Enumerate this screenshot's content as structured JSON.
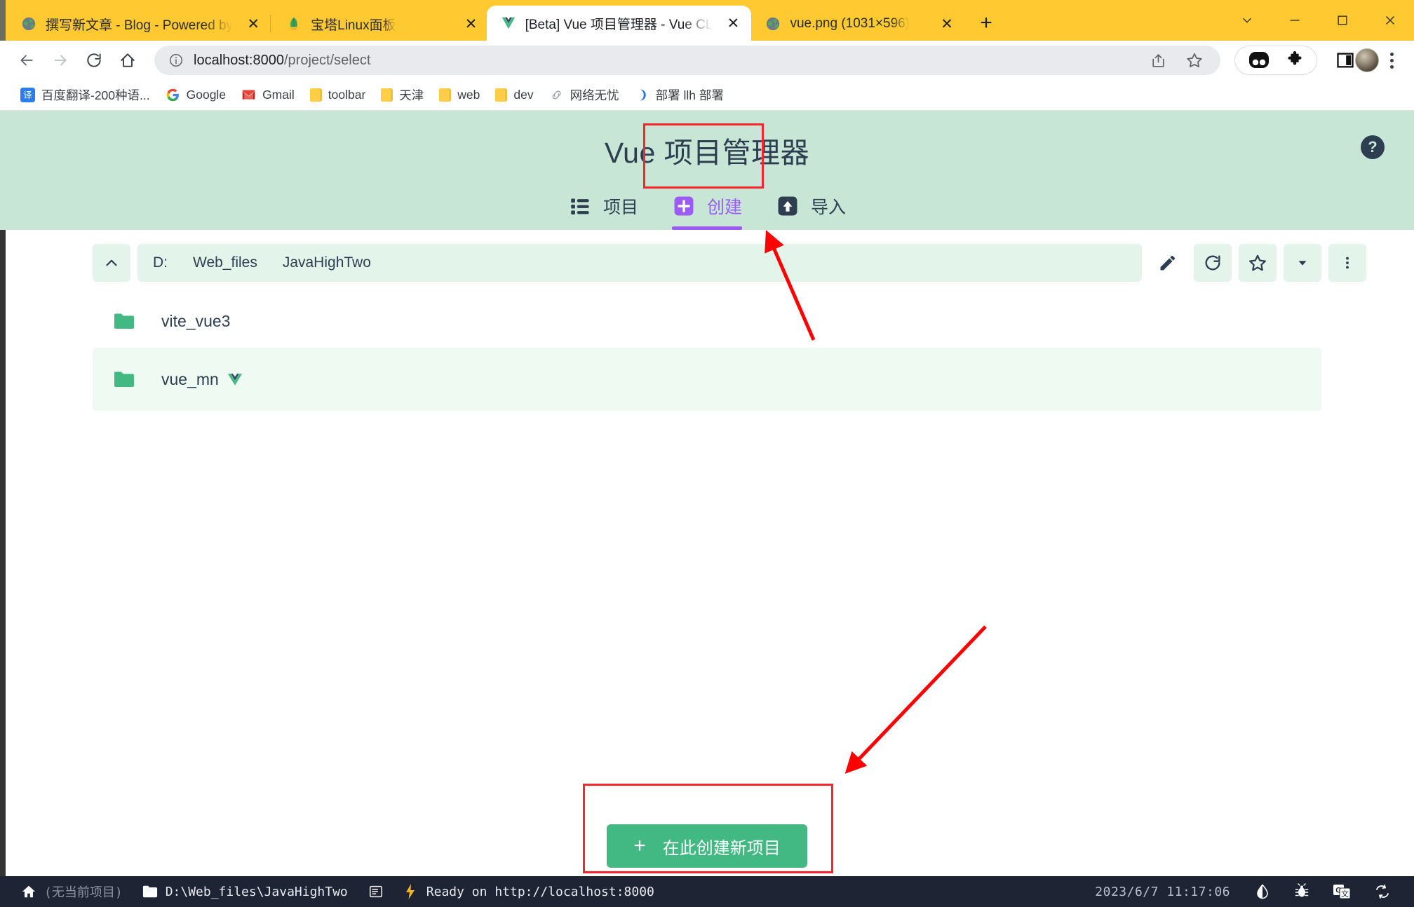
{
  "browser": {
    "tabs": [
      {
        "title": "撰写新文章 - Blog - Powered by",
        "favicon": "globe-icon",
        "active": false
      },
      {
        "title": "宝塔Linux面板",
        "favicon": "bt-panel-icon",
        "active": false
      },
      {
        "title": "[Beta] Vue 项目管理器 - Vue CL",
        "favicon": "vue-icon",
        "active": true
      },
      {
        "title": "vue.png (1031×596)",
        "favicon": "globe-icon",
        "active": false
      }
    ],
    "new_tab_label": "+",
    "window_controls": [
      "chevron-down",
      "minimize",
      "maximize",
      "close"
    ],
    "nav": {
      "back": "←",
      "forward": "→",
      "reload": "⟳",
      "home": "⌂"
    },
    "omnibox": {
      "info_icon": "info-circle-icon",
      "url_host": "localhost:8000",
      "url_path": "/project/select",
      "share_icon": "share-icon",
      "bookmark_icon": "star-icon"
    },
    "bookmarks": [
      {
        "label": "百度翻译-200种语...",
        "icon": "translate-icon"
      },
      {
        "label": "Google",
        "icon": "google-icon"
      },
      {
        "label": "Gmail",
        "icon": "gmail-icon"
      },
      {
        "label": "toolbar",
        "icon": "folder-icon"
      },
      {
        "label": "天津",
        "icon": "folder-icon"
      },
      {
        "label": "web",
        "icon": "folder-icon"
      },
      {
        "label": "dev",
        "icon": "folder-icon"
      },
      {
        "label": "网络无忧",
        "icon": "link-slash-icon"
      },
      {
        "label": "部署 llh 部署",
        "icon": "moon-icon"
      }
    ]
  },
  "app": {
    "title": "Vue 项目管理器",
    "help_label": "?",
    "tabs": [
      {
        "label": "项目",
        "icon": "list-icon",
        "selected": false
      },
      {
        "label": "创建",
        "icon": "plus-square-icon",
        "selected": true
      },
      {
        "label": "导入",
        "icon": "import-icon",
        "selected": false
      }
    ],
    "path_bar": {
      "up_button": "chevron-up-icon",
      "crumbs": [
        "D:",
        "Web_files",
        "JavaHighTwo"
      ],
      "actions": [
        {
          "name": "edit-path-button",
          "icon": "pencil-icon"
        },
        {
          "name": "refresh-button",
          "icon": "refresh-icon"
        },
        {
          "name": "favorite-button",
          "icon": "star-icon"
        },
        {
          "name": "favorites-dropdown-button",
          "icon": "chevron-down-icon"
        },
        {
          "name": "more-options-button",
          "icon": "kebab-icon"
        }
      ]
    },
    "folders": [
      {
        "name": "vite_vue3",
        "icon": "folder-icon",
        "has_vue_marker": false,
        "selected": false
      },
      {
        "name": "vue_mn",
        "icon": "folder-icon",
        "has_vue_marker": true,
        "selected": true
      }
    ],
    "create_button": {
      "plus": "+",
      "label": "在此创建新项目"
    },
    "colors": {
      "header_bg": "#c8e6d5",
      "accent_purple": "#9b5cf6",
      "green": "#42b983",
      "dark_slate": "#2c3e50",
      "highlight_red": "#f5252d"
    }
  },
  "statusbar": {
    "home_icon": "home-icon",
    "project_label": "(无当前项目)",
    "folder_icon": "folder-icon",
    "path": "D:\\Web_files\\JavaHighTwo",
    "terminal_icon": "terminal-icon",
    "bolt_icon": "bolt-icon",
    "ready_text": "Ready on http://localhost:8000",
    "datetime": "2023/6/7 11:17:06",
    "right_icons": [
      "theme-icon",
      "bug-icon",
      "translate-icon",
      "sync-icon"
    ]
  }
}
